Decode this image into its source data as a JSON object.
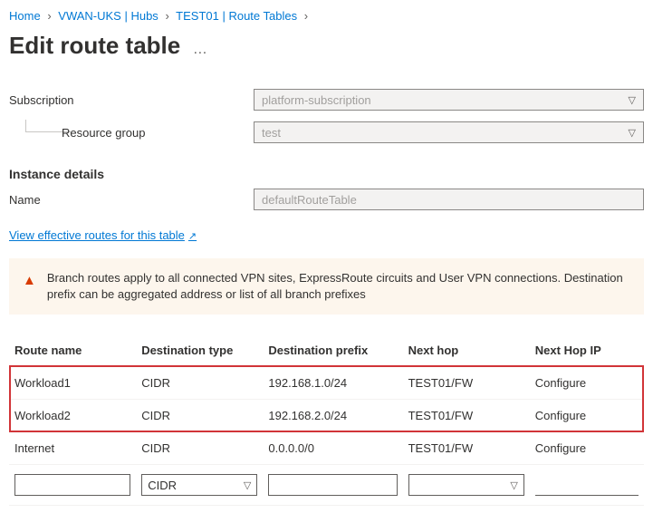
{
  "breadcrumb": {
    "items": [
      "Home",
      "VWAN-UKS | Hubs",
      "TEST01 | Route Tables"
    ],
    "current": ""
  },
  "page": {
    "title": "Edit route table"
  },
  "fields": {
    "subscription_label": "Subscription",
    "subscription_value": "platform-subscription",
    "resource_group_label": "Resource group",
    "resource_group_value": "test"
  },
  "instance": {
    "section_title": "Instance details",
    "name_label": "Name",
    "name_value": "defaultRouteTable"
  },
  "link": {
    "effective_routes": "View effective routes for this table"
  },
  "info": {
    "message": "Branch routes apply to all connected VPN sites, ExpressRoute circuits and User VPN connections. Destination prefix can be aggregated address or list of all branch prefixes"
  },
  "table": {
    "headers": {
      "route_name": "Route name",
      "dest_type": "Destination type",
      "dest_prefix": "Destination prefix",
      "next_hop": "Next hop",
      "next_hop_ip": "Next Hop IP"
    },
    "rows": [
      {
        "name": "Workload1",
        "type": "CIDR",
        "prefix": "192.168.1.0/24",
        "hop": "TEST01/FW",
        "ip": "Configure"
      },
      {
        "name": "Workload2",
        "type": "CIDR",
        "prefix": "192.168.2.0/24",
        "hop": "TEST01/FW",
        "ip": "Configure"
      },
      {
        "name": "Internet",
        "type": "CIDR",
        "prefix": "0.0.0.0/0",
        "hop": "TEST01/FW",
        "ip": "Configure"
      }
    ],
    "editor": {
      "name": "",
      "type": "CIDR",
      "prefix": "",
      "hop": "",
      "ip": ""
    }
  }
}
